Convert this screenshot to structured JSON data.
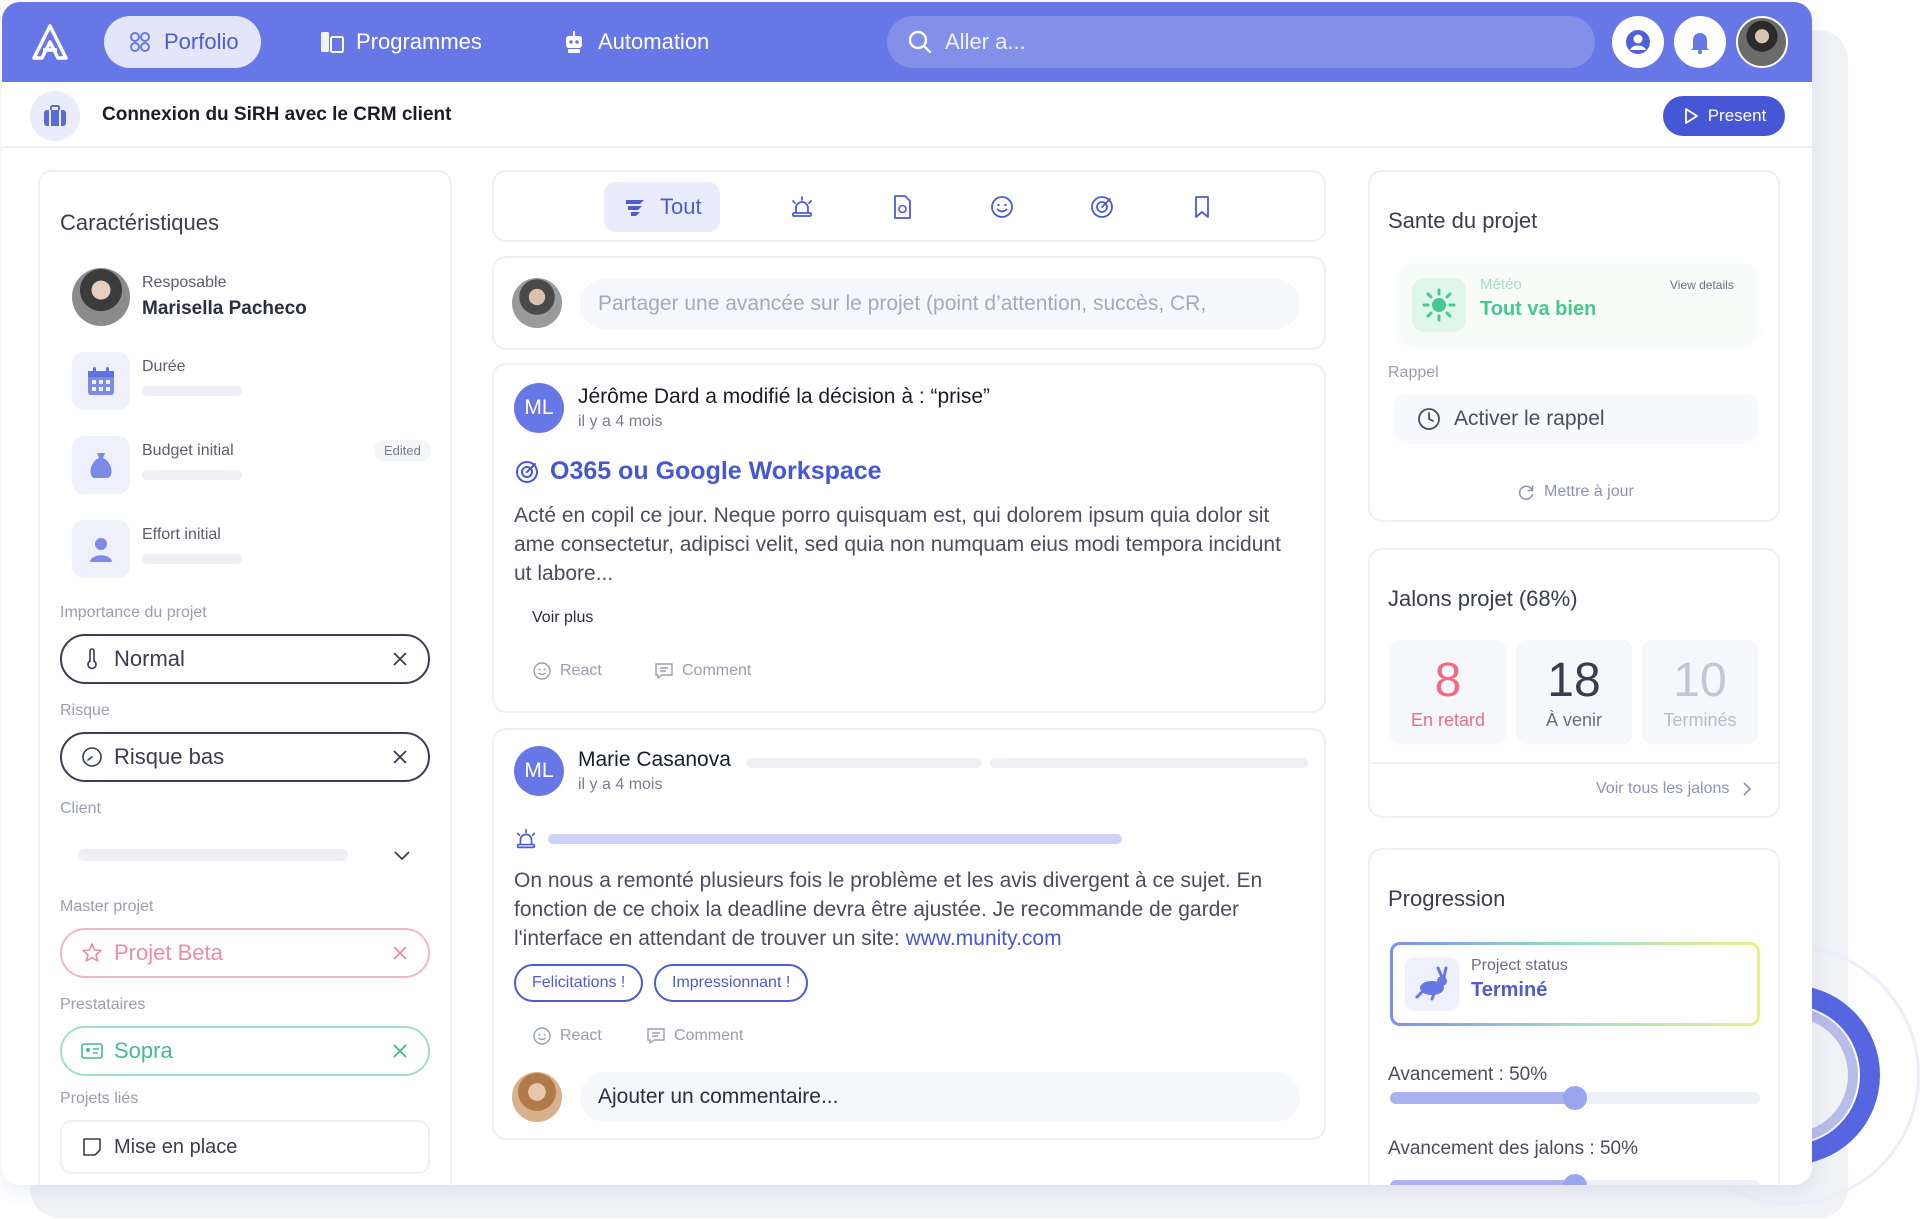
{
  "nav": {
    "items": [
      {
        "label": "Porfolio",
        "icon": "portfolio-icon",
        "active": true
      },
      {
        "label": "Programmes",
        "icon": "programmes-icon",
        "active": false
      },
      {
        "label": "Automation",
        "icon": "robot-icon",
        "active": false
      }
    ],
    "search_placeholder": "Aller a..."
  },
  "header": {
    "project_title": "Connexion du SiRH avec le CRM client",
    "present_label": "Present"
  },
  "left": {
    "title": "Caractéristiques",
    "responsable_label": "Resposable",
    "responsable_name": "Marisella Pacheco",
    "duree_label": "Durée",
    "budget_label": "Budget initial",
    "edited_tag": "Edited",
    "effort_label": "Effort initial",
    "importance_label": "Importance du projet",
    "importance_value": "Normal",
    "risque_label": "Risque",
    "risque_value": "Risque bas",
    "client_label": "Client",
    "master_label": "Master projet",
    "master_value": "Projet Beta",
    "prestataires_label": "Prestataires",
    "prestataires_value": "Sopra",
    "projets_lies_label": "Projets liés",
    "projets_lies_value": "Mise en place"
  },
  "feed": {
    "filter_all": "Tout",
    "share_placeholder": "Partager une avancée sur le projet (point d’attention, succès, CR,",
    "post1": {
      "initials": "ML",
      "author_line": "Jérôme Dard a modifié la décision à : “prise”",
      "time": "il y a 4 mois",
      "title": "O365 ou Google Workspace",
      "body": "Acté en copil ce jour. Neque porro quisquam est, qui dolorem ipsum quia dolor sit ame consectetur, adipisci velit, sed quia non numquam eius modi tempora incidunt ut labore...",
      "more": "Voir plus",
      "react": "React",
      "comment": "Comment"
    },
    "post2": {
      "initials": "ML",
      "author": "Marie Casanova",
      "time": "il y a 4 mois",
      "body": "On nous a remonté plusieurs fois le problème et les avis divergent à ce sujet. En fonction de ce choix la deadline devra être ajustée. Je recommande de garder l'interface en attendant de trouver un site: ",
      "link": "www.munity.com",
      "chip1": "Felicitations !",
      "chip2": "Impressionnant !",
      "react": "React",
      "comment": "Comment",
      "comment_placeholder": "Ajouter un commentaire..."
    }
  },
  "health": {
    "title": "Sante du projet",
    "meteo_label": "Météo",
    "meteo_value": "Tout va bien",
    "view_details": "View details",
    "rappel_label": "Rappel",
    "rappel_button": "Activer le rappel",
    "update": "Mettre à jour"
  },
  "milestones": {
    "title": "Jalons projet (68%)",
    "late_count": "8",
    "late_label": "En retard",
    "upcoming_count": "18",
    "upcoming_label": "À venir",
    "done_count": "10",
    "done_label": "Terminés",
    "see_all": "Voir tous les jalons"
  },
  "progress": {
    "title": "Progression",
    "status_label": "Project status",
    "status_value": "Terminé",
    "avancement_label": "Avancement : 50%",
    "avancement_value": 0.5,
    "jalons_label": "Avancement des jalons : 50%",
    "jalons_value": 0.5
  },
  "colors": {
    "primary": "#6877e6",
    "accent": "#4657d6",
    "late": "#ef6b86",
    "good": "#48c78e"
  }
}
